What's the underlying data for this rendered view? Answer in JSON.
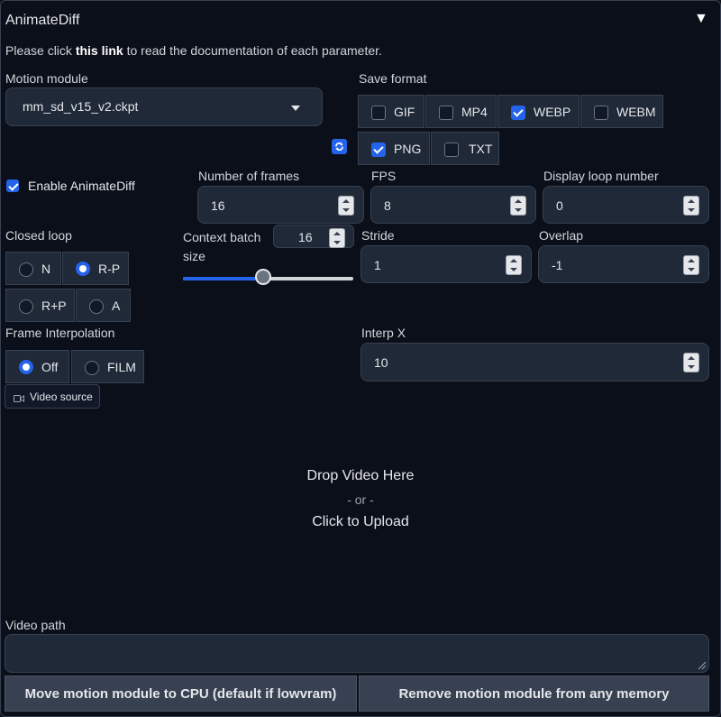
{
  "panel": {
    "title": "AnimateDiff",
    "collapse_icon": "triangle-down-icon"
  },
  "doc": {
    "prefix": "Please click ",
    "link": "this link",
    "suffix": " to read the documentation of each parameter."
  },
  "motion_module": {
    "label": "Motion module",
    "value": "mm_sd_v15_v2.ckpt"
  },
  "save_format": {
    "label": "Save format",
    "options": [
      {
        "label": "GIF",
        "checked": false
      },
      {
        "label": "MP4",
        "checked": false
      },
      {
        "label": "WEBP",
        "checked": true
      },
      {
        "label": "WEBM",
        "checked": false
      },
      {
        "label": "PNG",
        "checked": true
      },
      {
        "label": "TXT",
        "checked": false
      }
    ]
  },
  "refresh_icon": "refresh-icon",
  "enable": {
    "label": "Enable AnimateDiff",
    "checked": true
  },
  "frames": {
    "label": "Number of frames",
    "value": "16"
  },
  "fps": {
    "label": "FPS",
    "value": "8"
  },
  "loop": {
    "label": "Display loop number",
    "value": "0"
  },
  "closed_loop": {
    "label": "Closed loop",
    "options": [
      {
        "label": "N",
        "selected": false
      },
      {
        "label": "R-P",
        "selected": true
      },
      {
        "label": "R+P",
        "selected": false
      },
      {
        "label": "A",
        "selected": false
      }
    ]
  },
  "context_batch": {
    "label": "Context batch size",
    "value": "16",
    "slider_fraction": 0.47
  },
  "stride": {
    "label": "Stride",
    "value": "1"
  },
  "overlap": {
    "label": "Overlap",
    "value": "-1"
  },
  "frame_interp": {
    "label": "Frame Interpolation",
    "options": [
      {
        "label": "Off",
        "selected": true
      },
      {
        "label": "FILM",
        "selected": false
      }
    ]
  },
  "interp_x": {
    "label": "Interp X",
    "value": "10"
  },
  "video_source": {
    "label": "Video source",
    "icon": "video-camera-icon"
  },
  "drop": {
    "line1": "Drop Video Here",
    "line2": "- or -",
    "line3": "Click to Upload"
  },
  "video_path": {
    "label": "Video path",
    "value": ""
  },
  "buttons": {
    "move_cpu": "Move motion module to CPU (default if lowvram)",
    "remove": "Remove motion module from any memory"
  }
}
